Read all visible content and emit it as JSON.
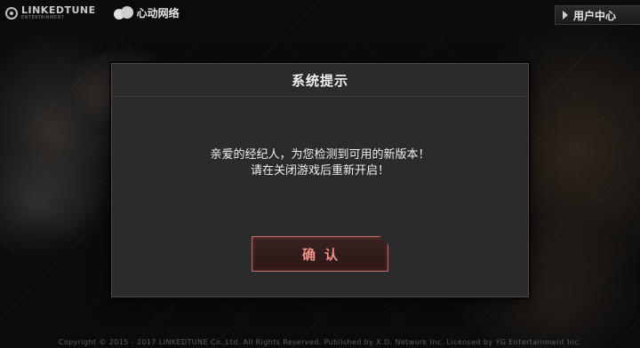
{
  "logos": {
    "linkedtune": "LINKEDTUNE",
    "linkedtune_sub": "ENTERTAINMENT",
    "xinyou": "心动网络"
  },
  "header": {
    "user_center_label": "用户中心"
  },
  "dialog": {
    "title": "系统提示",
    "message_line1": "亲爱的经纪人，为您检测到可用的新版本！",
    "message_line2": "请在关闭游戏后重新开启！",
    "confirm_label": "确认"
  },
  "footer": {
    "copyright": "Copyright © 2015 - 2017 LINKEDTUNE Co.,Ltd. All Rights Reserved. Published by X.D. Network Inc. Licensed by YG Entertainment Inc."
  },
  "colors": {
    "dialog_bg": "#2b2a2d",
    "accent": "#f2918a"
  }
}
